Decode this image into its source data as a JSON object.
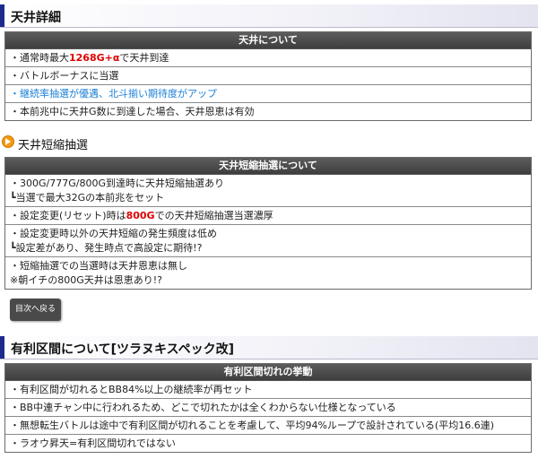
{
  "section1": {
    "title": "天井詳細",
    "table_header": "天井について",
    "rows": {
      "r1_pre": "・通常時最大",
      "r1_red": "1268G+α",
      "r1_post": "で天井到達",
      "r2": "・バトルボーナスに当選",
      "r3": "・継続率抽選が優遇、北斗揃い期待度がアップ",
      "r4": "・本前兆中に天井G数に到達した場合、天井恩恵は有効"
    }
  },
  "section2": {
    "title": "天井短縮抽選",
    "table_header": "天井短縮抽選について",
    "rows": {
      "r1_line1": "・300G/777G/800G到達時に天井短縮抽選あり",
      "r1_line2": "┗当選で最大32Gの本前兆をセット",
      "r2_pre": "・設定変更(リセット)時は",
      "r2_red": "800G",
      "r2_post": "での天井短縮抽選当選濃厚",
      "r3_line1": "・設定変更時以外の天井短縮の発生頻度は低め",
      "r3_line2": "┗設定差があり、発生時点で高設定に期待!?",
      "r4_line1": "・短縮抽選での当選時は天井恩恵は無し",
      "r4_line2": "※朝イチの800G天井は恩恵あり!?"
    }
  },
  "back_button": {
    "label": "目次へ戻る"
  },
  "section3": {
    "title": "有利区間について[ツラヌキスペック改]",
    "table_header": "有利区間切れの挙動",
    "rows": {
      "r1": "・有利区間が切れるとBB84%以上の継続率が再セット",
      "r2": "・BB中連チャン中に行われるため、どこで切れたかは全くわからない仕様となっている",
      "r3": "・無想転生バトルは途中で有利区間が切れることを考慮して、平均94%ループで設計されている(平均16.6連)",
      "r4": "・ラオウ昇天=有利区間切れではない"
    }
  },
  "colors": {
    "accent_bar": "#1e2a8c",
    "highlight_red": "#e00000",
    "highlight_blue": "#1a7fd6",
    "table_header_bg": "#4a4a4a"
  },
  "icons": {
    "sub_heading": "orange-arrow-circle-icon"
  }
}
